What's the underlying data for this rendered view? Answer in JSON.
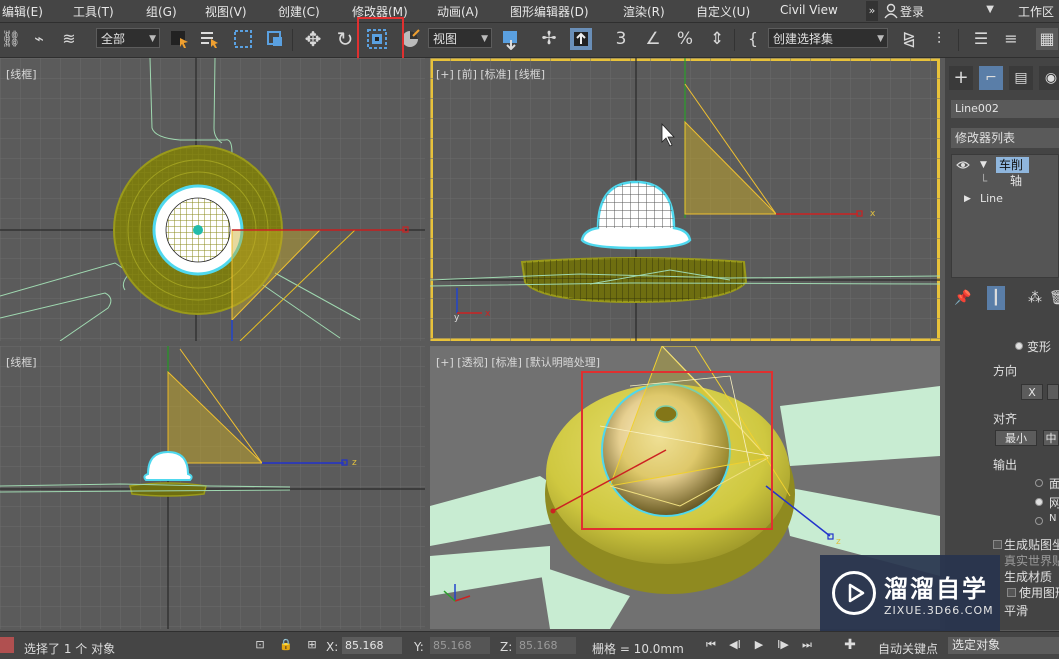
{
  "menu": {
    "items": [
      "编辑(E)",
      "工具(T)",
      "组(G)",
      "视图(V)",
      "创建(C)",
      "修改器(M)",
      "动画(A)",
      "图形编辑器(D)",
      "渲染(R)",
      "自定义(U)",
      "Civil View"
    ],
    "more": "»",
    "login": "登录",
    "workspace": "工作区"
  },
  "toolbar": {
    "filter_select": "全部",
    "ref_coord_select": "视图",
    "named_sel_select": "创建选择集",
    "highlight_color": "#e03030"
  },
  "viewports": {
    "top": {
      "label": "[线框]"
    },
    "front": {
      "label": "[+] [前] [标准] [线框]",
      "active_border": "#e8c23a"
    },
    "left": {
      "label": "[线框]"
    },
    "persp": {
      "label": "[+] [透视] [标准] [默认明暗处理]"
    },
    "axis": {
      "x": "x",
      "y": "y",
      "z": "z"
    }
  },
  "command_panel": {
    "object_name": "Line002",
    "modifier_list": "修改器列表",
    "stack": {
      "lathe": "车削",
      "axis": "轴",
      "line": "Line"
    },
    "params": {
      "morph": "变形",
      "direction": "方向",
      "dir_x": "X",
      "align": "对齐",
      "align_min": "最小",
      "align_center": "中",
      "output": "输出",
      "out_patch": "面",
      "out_mesh": "网",
      "out_nurbs": "N",
      "gen_mapping": "生成贴图坐",
      "real_world": "真实世界贴",
      "gen_material": "生成材质",
      "use_shape": "使用图形",
      "smooth": "平滑"
    }
  },
  "watermark": {
    "title": "溜溜自学",
    "url": "ZIXUE.3D66.COM"
  },
  "status": {
    "selection": "选择了 1 个 对象",
    "x_label": "X:",
    "x_value": "85.168",
    "y_label": "Y:",
    "y_value": "85.168",
    "z_label": "Z:",
    "z_value": "85.168",
    "grid": "栅格 = 10.0mm",
    "auto_key": "自动关键点",
    "selected_object": "选定对象"
  }
}
